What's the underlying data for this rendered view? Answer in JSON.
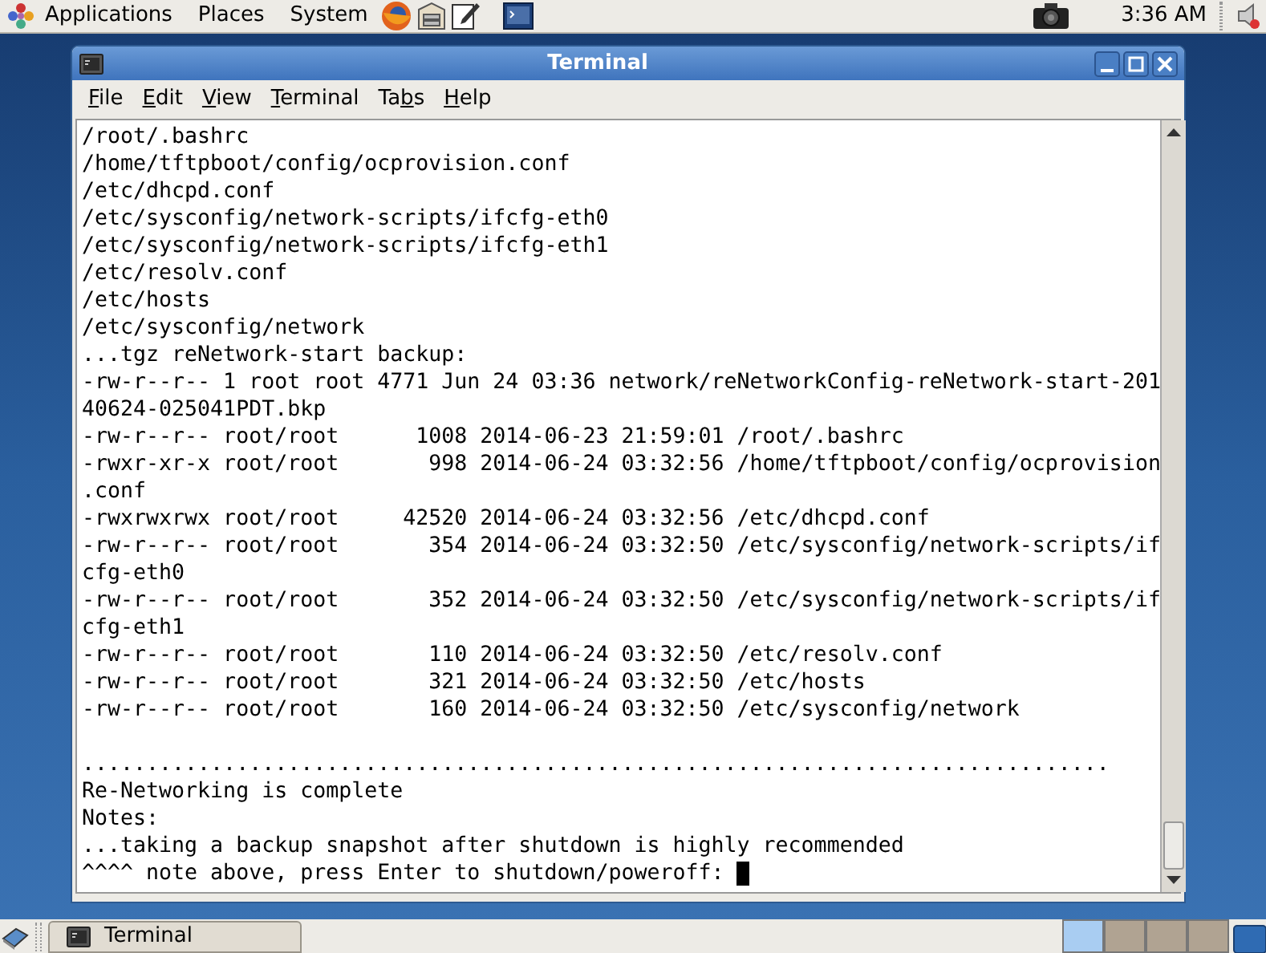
{
  "top_panel": {
    "menus": [
      "Applications",
      "Places",
      "System"
    ],
    "clock": "3:36 AM"
  },
  "window": {
    "title": "Terminal",
    "menu": [
      {
        "mnemonic": "F",
        "after": "ile"
      },
      {
        "mnemonic": "E",
        "after": "dit"
      },
      {
        "mnemonic": "V",
        "after": "iew"
      },
      {
        "mnemonic": "T",
        "after": "erminal"
      },
      {
        "before": "Ta",
        "mnemonic": "b",
        "after": "s"
      },
      {
        "mnemonic": "H",
        "after": "elp"
      }
    ],
    "blocks": [
      [
        "/root/.bashrc",
        "/home/tftpboot/config/ocprovision.conf",
        "/etc/dhcpd.conf",
        "/etc/sysconfig/network-scripts/ifcfg-eth0",
        "/etc/sysconfig/network-scripts/ifcfg-eth1",
        "/etc/resolv.conf",
        "/etc/hosts",
        "/etc/sysconfig/network",
        "...tgz reNetwork-start backup:",
        "-rw-r--r-- 1 root root 4771 Jun 24 03:36 network/reNetworkConfig-reNetwork-start-201",
        "40624-025041PDT.bkp",
        "-rw-r--r-- root/root      1008 2014-06-23 21:59:01 /root/.bashrc",
        "-rwxr-xr-x root/root       998 2014-06-24 03:32:56 /home/tftpboot/config/ocprovision",
        ".conf",
        "-rwxrwxrwx root/root     42520 2014-06-24 03:32:56 /etc/dhcpd.conf",
        "-rw-r--r-- root/root       354 2014-06-24 03:32:50 /etc/sysconfig/network-scripts/if",
        "cfg-eth0",
        "-rw-r--r-- root/root       352 2014-06-24 03:32:50 /etc/sysconfig/network-scripts/if",
        "cfg-eth1",
        "-rw-r--r-- root/root       110 2014-06-24 03:32:50 /etc/resolv.conf",
        "-rw-r--r-- root/root       321 2014-06-24 03:32:50 /etc/hosts",
        "-rw-r--r-- root/root       160 2014-06-24 03:32:50 /etc/sysconfig/network"
      ],
      [
        "................................................................................",
        "Re-Networking is complete",
        "Notes:",
        "...taking a backup snapshot after shutdown is highly recommended",
        "^^^^ note above, press Enter to shutdown/poweroff: "
      ]
    ],
    "cursor": true
  },
  "taskbar": {
    "tasks": [
      {
        "label": "Terminal",
        "selected": false
      }
    ],
    "workspaces": [
      {
        "selected": true
      },
      {
        "selected": false
      },
      {
        "selected": false
      },
      {
        "selected": false
      }
    ]
  }
}
